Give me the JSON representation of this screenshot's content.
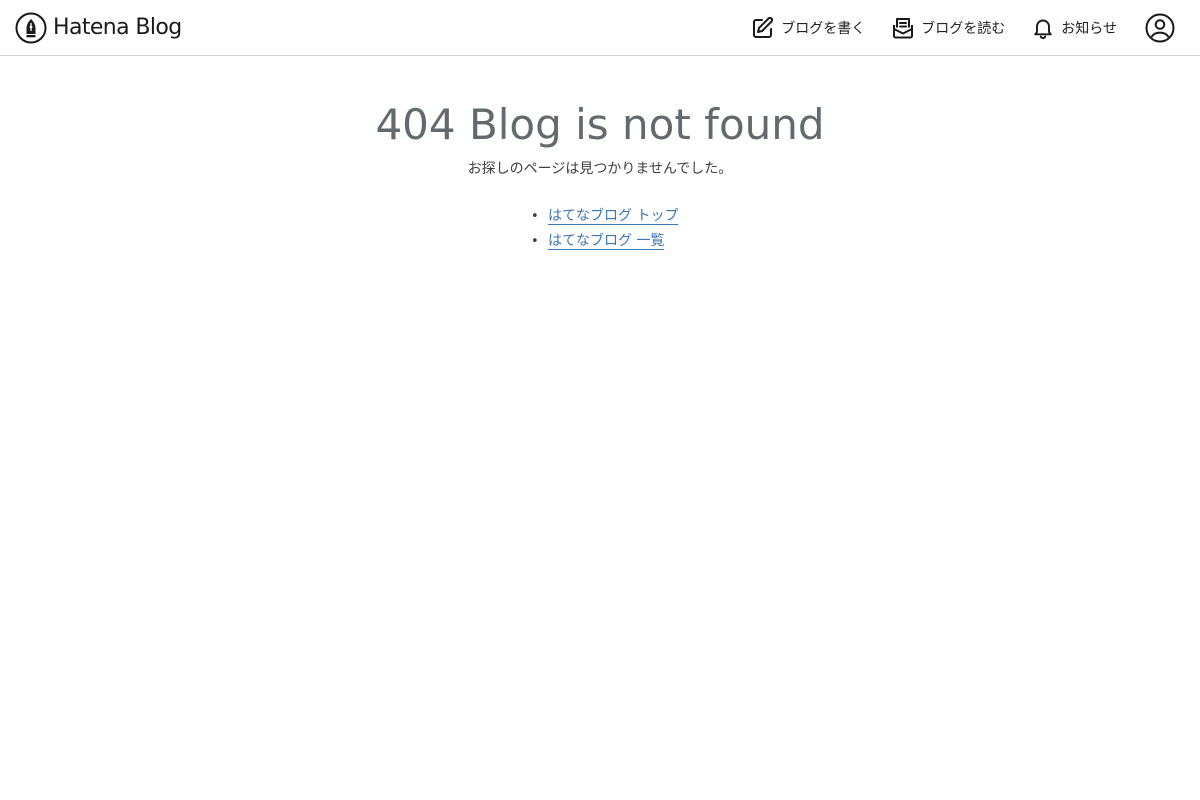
{
  "header": {
    "brand_name": "Hatena Blog",
    "brand_icon": "pen-nib-icon",
    "nav": [
      {
        "label": "ブログを書く",
        "icon": "edit-icon"
      },
      {
        "label": "ブログを読む",
        "icon": "mail-open-icon"
      },
      {
        "label": "お知らせ",
        "icon": "bell-icon"
      }
    ],
    "user_icon": "user-circle-icon"
  },
  "main": {
    "title": "404 Blog is not found",
    "description": "お探しのページは見つかりませんでした。",
    "links": [
      {
        "label": "はてなブログ トップ"
      },
      {
        "label": "はてなブログ 一覧"
      }
    ]
  },
  "colors": {
    "title": "#636a6e",
    "link": "#3a77b6",
    "header_border": "#d5d5d5"
  }
}
